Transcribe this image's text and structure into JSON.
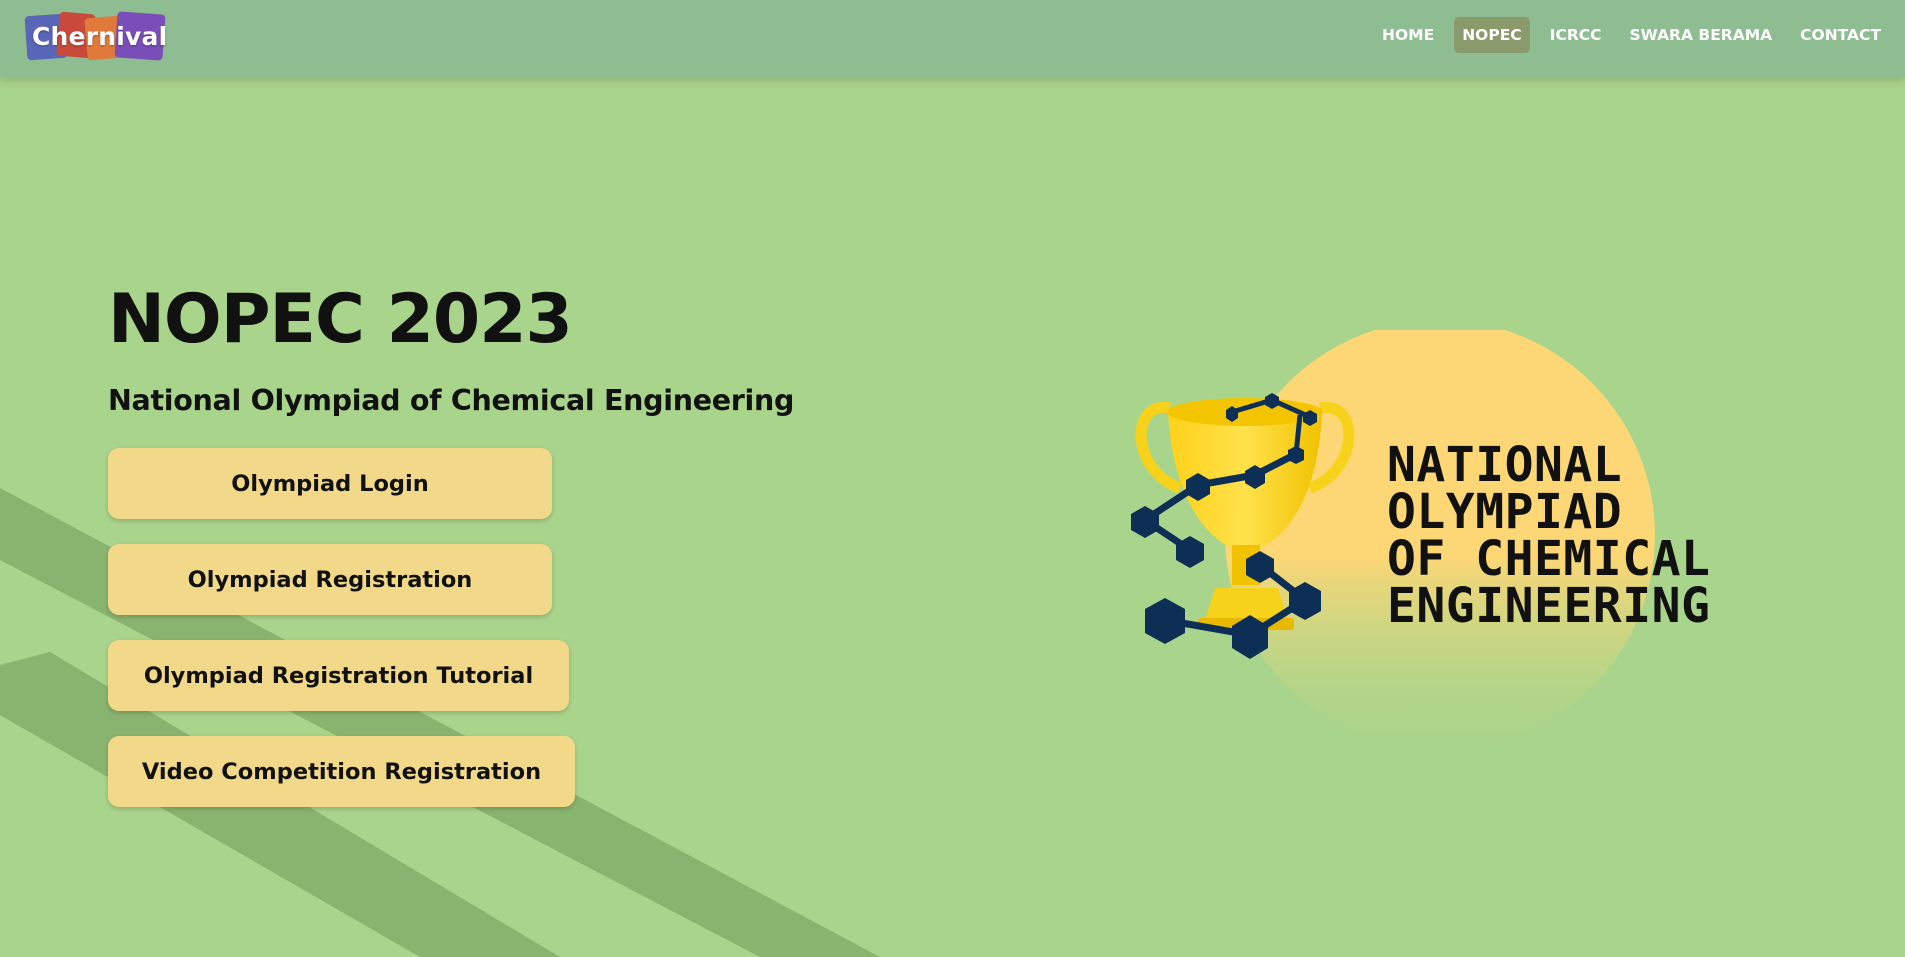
{
  "header": {
    "logo_text": "Chernival",
    "nav": [
      {
        "label": "HOME",
        "active": false
      },
      {
        "label": "NOPEC",
        "active": true
      },
      {
        "label": "ICRCC",
        "active": false
      },
      {
        "label": "SWARA BERAMA",
        "active": false
      },
      {
        "label": "CONTACT",
        "active": false
      }
    ]
  },
  "hero": {
    "title": "NOPEC 2023",
    "subtitle": "National Olympiad of Chemical Engineering",
    "buttons": [
      {
        "label": "Olympiad Login"
      },
      {
        "label": "Olympiad Registration"
      },
      {
        "label": "Olympiad Registration Tutorial"
      },
      {
        "label": "Video Competition Registration"
      }
    ]
  },
  "emblem": {
    "lines": [
      "NATIONAL",
      "OLYMPIAD",
      "OF CHEMICAL",
      "ENGINEERING"
    ]
  },
  "colors": {
    "background": "#a9d48b",
    "navbar": "#8fbd92",
    "nav_active": "#8a9a6a",
    "button": "#f2d98a",
    "trophy": "#f7d21a",
    "molecule": "#0d2e55",
    "sun": "#fdd776"
  }
}
